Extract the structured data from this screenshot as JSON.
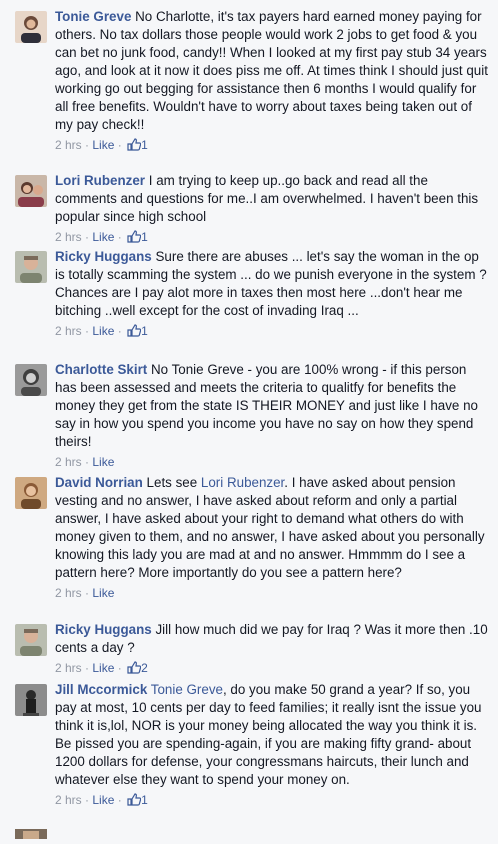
{
  "comments": [
    {
      "author": "Tonie Greve",
      "text": "No Charlotte, it's tax payers hard earned money paying for others. No tax dollars those people would work 2 jobs to get food & you can bet no junk food, candy!! When I looked at my first pay stub 34 years ago, and look at it now it does piss me off. At times think I should just quit working go out begging for assistance then 6 months I would qualify for all free benefits. Wouldn't have to worry about taxes being taken out of my pay check!!",
      "time": "2 hrs",
      "like_label": "Like",
      "like_count": "1",
      "avatar_color": "#6b4a3a"
    },
    {
      "author": "Lori Rubenzer",
      "text": "I am trying to keep up..go back and read all the comments and questions for me..I am overwhelmed. I haven't been this popular since high school",
      "time": "2 hrs",
      "like_label": "Like",
      "like_count": "1",
      "avatar_color": "#a0786a"
    },
    {
      "author": "Ricky Huggans",
      "text": "Sure there are abuses ... let's say the woman in the op is totally scamming the system ... do we punish everyone in the system ? Chances are I pay alot more in taxes then most here ...don't hear me bitching ..well except for the cost of invading Iraq ...",
      "time": "2 hrs",
      "like_label": "Like",
      "like_count": "1",
      "avatar_color": "#8a8f7a"
    },
    {
      "author": "Charlotte Skirt",
      "text": "No Tonie Greve - you are 100% wrong - if this person has been assessed and meets the criteria to qualitfy for benefits the money they get from the state IS THEIR MONEY and just like I have no say in how you spend you income you have no say on how they spend theirs!",
      "time": "2 hrs",
      "like_label": "Like",
      "like_count": "",
      "avatar_color": "#5a5a5a"
    },
    {
      "author": "David Norrian",
      "mention": "Lori Rubenzer",
      "text_before": "Lets see",
      "text": ". I have asked about pension vesting and no answer, I have asked about reform and only a partial answer, I have asked about your right to demand what others do with money given to them, and no answer, I have asked about you personally knowing this lady you are mad at and no answer. Hmmmm do I see a pattern here? More importantly do you see a pattern here?",
      "time": "2 hrs",
      "like_label": "Like",
      "like_count": "",
      "avatar_color": "#b07a50"
    },
    {
      "author": "Ricky Huggans",
      "text": "Jill how much did we pay for Iraq ? Was it more then .10 cents a day ?",
      "time": "2 hrs",
      "like_label": "Like",
      "like_count": "2",
      "avatar_color": "#8a8f7a"
    },
    {
      "author": "Jill Mccormick",
      "mention": "Tonie Greve",
      "text_before": "",
      "text": ", do you make 50 grand a year? If so, you pay at most, 10 cents per day to feed families; it really isnt the issue you think it is,lol, NOR is your money being allocated the way you think it is. Be pissed you are spending-again, if you are making fifty grand- about 1200 dollars for defense, your congressmans haircuts, their lunch and whatever else they want to spend your money on.",
      "time": "2 hrs",
      "like_label": "Like",
      "like_count": "1",
      "avatar_color": "#3a3a3a"
    }
  ],
  "separator": "·",
  "colors": {
    "link": "#3b5998",
    "meta": "#9197a3",
    "text": "#141823",
    "background": "#f6f7f9"
  }
}
